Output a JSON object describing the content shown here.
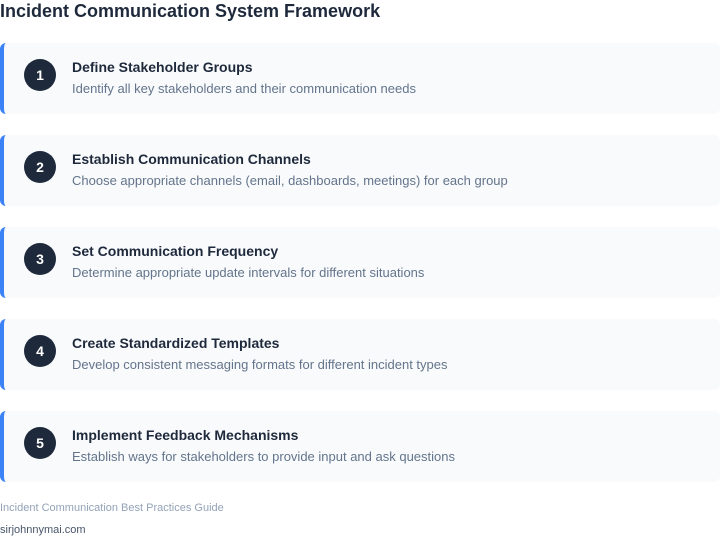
{
  "title": "Incident Communication System Framework",
  "accent_color": "#3b82f6",
  "steps": [
    {
      "number": "1",
      "title": "Define Stakeholder Groups",
      "description": "Identify all key stakeholders and their communication needs"
    },
    {
      "number": "2",
      "title": "Establish Communication Channels",
      "description": "Choose appropriate channels (email, dashboards, meetings) for each group"
    },
    {
      "number": "3",
      "title": "Set Communication Frequency",
      "description": "Determine appropriate update intervals for different situations"
    },
    {
      "number": "4",
      "title": "Create Standardized Templates",
      "description": "Develop consistent messaging formats for different incident types"
    },
    {
      "number": "5",
      "title": "Implement Feedback Mechanisms",
      "description": "Establish ways for stakeholders to provide input and ask questions"
    }
  ],
  "footer": {
    "source": "Incident Communication Best Practices Guide",
    "site": "sirjohnnymai.com"
  }
}
